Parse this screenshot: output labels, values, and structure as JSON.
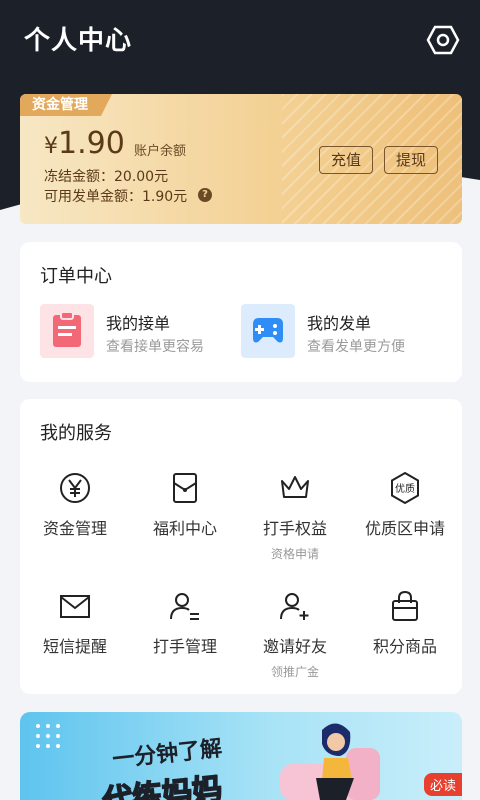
{
  "header": {
    "title": "个人中心"
  },
  "balance": {
    "tag": "资金管理",
    "currency": "¥",
    "amount": "1.90",
    "amount_label": "账户余额",
    "frozen": "冻结金额：20.00元",
    "available": "可用发单金额：1.90元",
    "recharge": "充值",
    "withdraw": "提现"
  },
  "orders": {
    "title": "订单中心",
    "items": [
      {
        "title": "我的接单",
        "sub": "查看接单更容易",
        "icon": "clipboard-icon",
        "color": "#f05a6a"
      },
      {
        "title": "我的发单",
        "sub": "查看发单更方便",
        "icon": "gamepad-icon",
        "color": "#2f8df5"
      }
    ]
  },
  "services": {
    "title": "我的服务",
    "items": [
      {
        "label": "资金管理",
        "sub": "",
        "icon": "yen-icon"
      },
      {
        "label": "福利中心",
        "sub": "",
        "icon": "gift-envelope-icon"
      },
      {
        "label": "打手权益",
        "sub": "资格申请",
        "icon": "crown-icon"
      },
      {
        "label": "优质区申请",
        "sub": "",
        "icon": "quality-badge-icon",
        "badge": "优质"
      },
      {
        "label": "短信提醒",
        "sub": "",
        "icon": "mail-icon"
      },
      {
        "label": "打手管理",
        "sub": "",
        "icon": "user-list-icon"
      },
      {
        "label": "邀请好友",
        "sub": "领推广金",
        "icon": "add-user-icon"
      },
      {
        "label": "积分商品",
        "sub": "",
        "icon": "shopping-bag-icon"
      }
    ]
  },
  "banner": {
    "line1": "一分钟了解",
    "line2": "代练妈妈",
    "badge": "必读"
  }
}
